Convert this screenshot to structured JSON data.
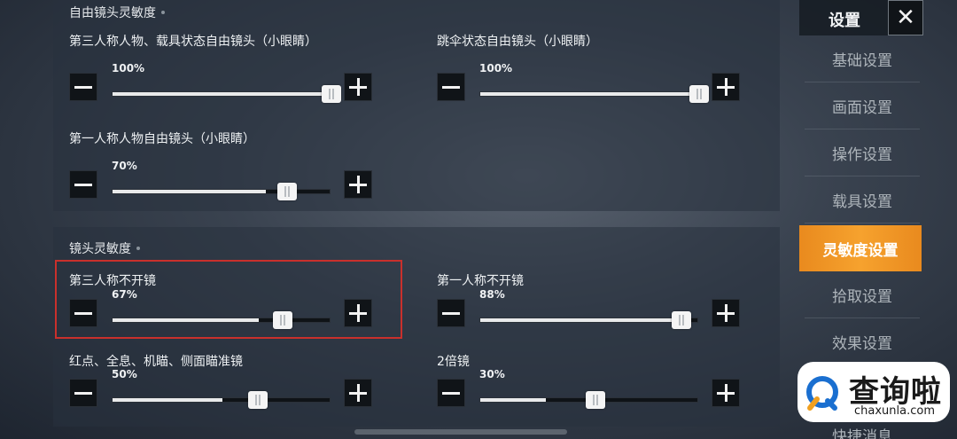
{
  "free_camera": {
    "title": "自由镜头灵敏度",
    "tpp_vehicle": {
      "label": "第三人称人物、载具状态自由镜头（小眼睛）",
      "value": "100%",
      "percent": 100
    },
    "parachute": {
      "label": "跳伞状态自由镜头（小眼睛）",
      "value": "100%",
      "percent": 100
    },
    "fpp": {
      "label": "第一人称人物自由镜头（小眼睛）",
      "value": "70%",
      "percent": 70
    }
  },
  "camera": {
    "title": "镜头灵敏度",
    "tpp_noscope": {
      "label": "第三人称不开镜",
      "value": "67%",
      "percent": 67
    },
    "fpp_noscope": {
      "label": "第一人称不开镜",
      "value": "88%",
      "percent": 88
    },
    "red_dot": {
      "label": "红点、全息、机瞄、侧面瞄准镜",
      "value": "50%",
      "percent": 50
    },
    "scope2x": {
      "label": "2倍镜",
      "value": "30%",
      "percent": 30
    }
  },
  "sidebar": {
    "title": "设置",
    "close": "✕",
    "items": [
      {
        "label": "基础设置"
      },
      {
        "label": "画面设置"
      },
      {
        "label": "操作设置"
      },
      {
        "label": "载具设置"
      },
      {
        "label": "灵敏度设置"
      },
      {
        "label": "拾取设置"
      },
      {
        "label": "效果设置"
      },
      {
        "label": "快捷消息"
      }
    ]
  },
  "watermark": {
    "text": "查询啦",
    "url": "chaxunla.com"
  },
  "colors": {
    "accent": "#f6a22e",
    "highlight": "#c9302c"
  }
}
